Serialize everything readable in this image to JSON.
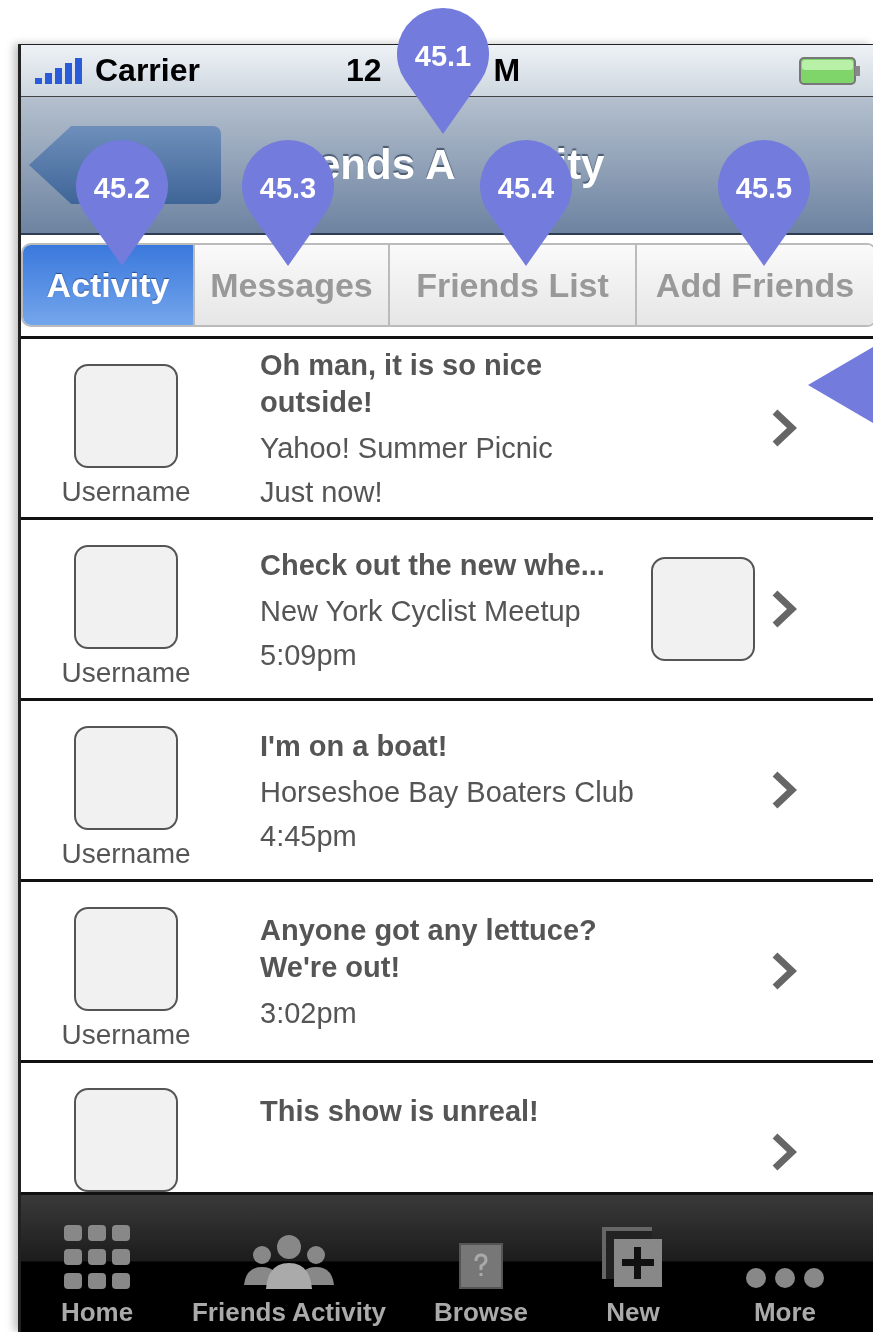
{
  "status_bar": {
    "carrier": "Carrier",
    "time_left": "12",
    "time_right": "M"
  },
  "nav_bar": {
    "title_parts": [
      "ends A",
      "ity"
    ]
  },
  "tabs": [
    {
      "label": "Activity",
      "selected": true
    },
    {
      "label": "Messages",
      "selected": false
    },
    {
      "label": "Friends List",
      "selected": false
    },
    {
      "label": "Add Friends",
      "selected": false
    }
  ],
  "rows": [
    {
      "username": "Username",
      "title": "Oh man, it is so nice outside!",
      "group": "Yahoo! Summer Picnic",
      "time": "Just now!",
      "thumbnail": false
    },
    {
      "username": "Username",
      "title": "Check out the new whe...",
      "group": "New York Cyclist Meetup",
      "time": "5:09pm",
      "thumbnail": true
    },
    {
      "username": "Username",
      "title": "I'm on a boat!",
      "group": "Horseshoe Bay Boaters Club",
      "time": "4:45pm",
      "thumbnail": false
    },
    {
      "username": "Username",
      "title": "Anyone got any lettuce? We're out!",
      "time": "3:02pm",
      "thumbnail": false
    },
    {
      "title": "This show is unreal!",
      "thumbnail": false
    }
  ],
  "tab_bar": [
    {
      "label": "Home",
      "kind": "grid"
    },
    {
      "label": "Friends Activity",
      "kind": "people"
    },
    {
      "label": "Browse",
      "kind": "question"
    },
    {
      "label": "New",
      "kind": "new"
    },
    {
      "label": "More",
      "kind": "dots"
    }
  ],
  "pins": [
    {
      "label": "45.1",
      "kind": "down"
    },
    {
      "label": "45.2",
      "kind": "down"
    },
    {
      "label": "45.3",
      "kind": "down"
    },
    {
      "label": "45.4",
      "kind": "down"
    },
    {
      "label": "45.5",
      "kind": "down"
    },
    {
      "kind": "left"
    }
  ]
}
